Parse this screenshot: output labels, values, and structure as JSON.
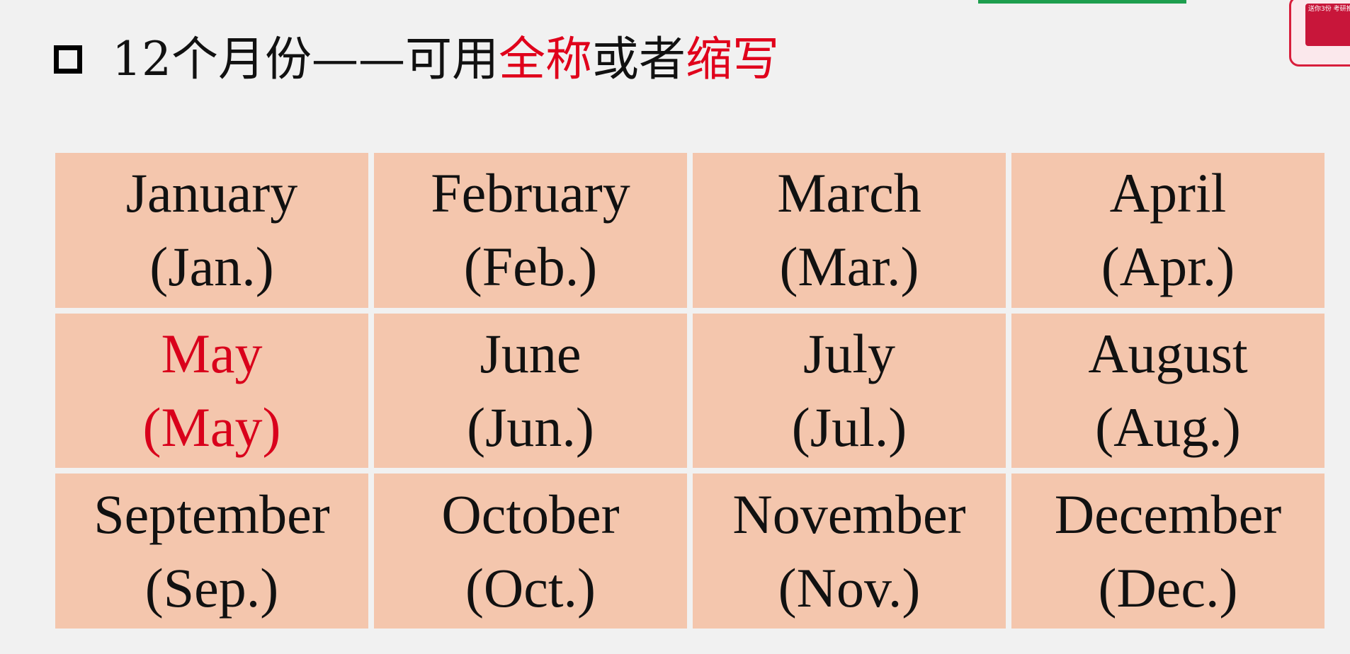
{
  "heading": {
    "prefix": "12个月份——可用",
    "full_name": "全称",
    "conjunction": "或者",
    "abbreviation": "缩写"
  },
  "badge": {
    "text": "送你3份 考研推荐"
  },
  "months": [
    {
      "full": "January",
      "abbr": "(Jan.)"
    },
    {
      "full": "February",
      "abbr": "(Feb.)"
    },
    {
      "full": "March",
      "abbr": "(Mar.)"
    },
    {
      "full": "April",
      "abbr": "(Apr.)"
    },
    {
      "full": "May",
      "abbr": "(May)",
      "highlight": true
    },
    {
      "full": "June",
      "abbr": "(Jun.)"
    },
    {
      "full": "July",
      "abbr": "(Jul.)"
    },
    {
      "full": "August",
      "abbr": "(Aug.)"
    },
    {
      "full": "September",
      "abbr": "(Sep.)"
    },
    {
      "full": "October",
      "abbr": "(Oct.)"
    },
    {
      "full": "November",
      "abbr": "(Nov.)"
    },
    {
      "full": "December",
      "abbr": "(Dec.)"
    }
  ],
  "colors": {
    "cell_background": "#f4c6ad",
    "highlight_text": "#e0001b",
    "page_background": "#f1f1f1"
  }
}
